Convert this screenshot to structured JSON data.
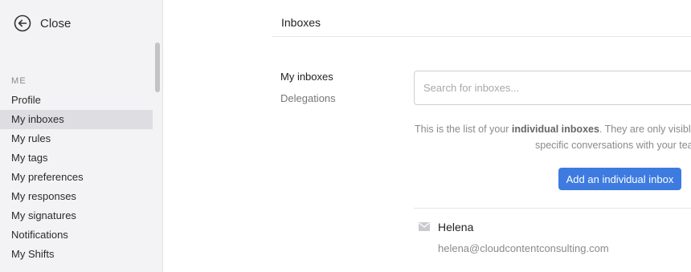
{
  "sidebar": {
    "close_label": "Close",
    "section_title": "ME",
    "items": [
      {
        "label": "Profile"
      },
      {
        "label": "My inboxes"
      },
      {
        "label": "My rules"
      },
      {
        "label": "My tags"
      },
      {
        "label": "My preferences"
      },
      {
        "label": "My responses"
      },
      {
        "label": "My signatures"
      },
      {
        "label": "Notifications"
      },
      {
        "label": "My Shifts"
      }
    ],
    "active_item": "My inboxes"
  },
  "header": {
    "title": "Inboxes"
  },
  "subnav": {
    "items": [
      {
        "label": "My inboxes"
      },
      {
        "label": "Delegations"
      }
    ]
  },
  "search": {
    "placeholder": "Search for inboxes...",
    "value": ""
  },
  "description": {
    "prefix": "This is the list of your ",
    "bold": "individual inboxes",
    "suffix": ". They are only visible",
    "line2": "specific conversations with your tea"
  },
  "add_button_label": "Add an individual inbox",
  "inboxes": [
    {
      "name": "Helena",
      "email": "helena@cloudcontentconsulting.com",
      "icon": "mail-icon"
    }
  ],
  "colors": {
    "accent": "#3d7be0",
    "sidebar_bg": "#f3f3f5",
    "active_item_bg": "#dedee2"
  }
}
